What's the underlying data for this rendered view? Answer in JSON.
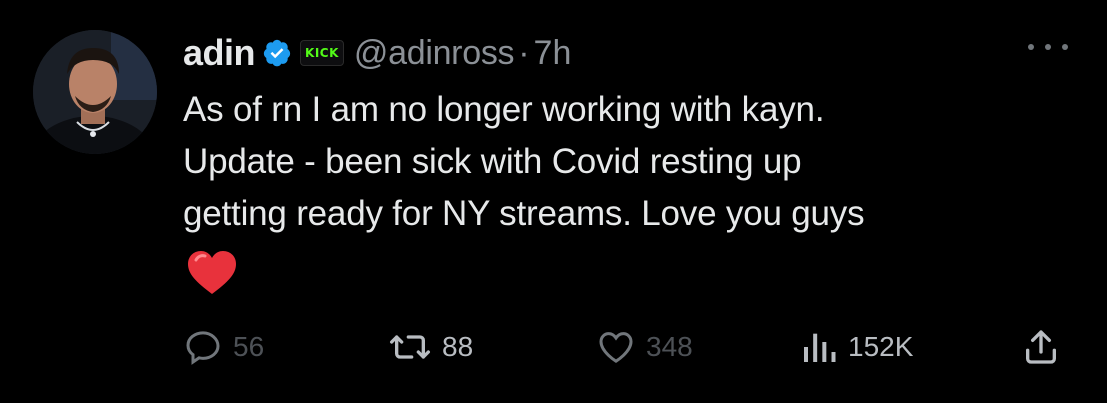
{
  "author": {
    "display_name": "adin",
    "handle": "@adinross",
    "separator": "·",
    "time": "7h",
    "kick_badge": "KICK"
  },
  "tweet": {
    "lines": [
      "As of rn I am no longer working with kayn.",
      "Update - been sick with Covid resting up",
      "getting ready for NY streams. Love you guys"
    ],
    "emoji": "red-heart"
  },
  "actions": {
    "replies": "56",
    "retweets": "88",
    "likes": "348",
    "views": "152K"
  },
  "icons": {
    "verified": "verified-badge-icon",
    "more": "more-icon",
    "reply": "reply-icon",
    "retweet": "retweet-icon",
    "like": "heart-icon",
    "views": "views-icon",
    "share": "share-icon"
  },
  "colors": {
    "background": "#000000",
    "text": "#e7e9ea",
    "secondary": "#8b9096",
    "verified_blue": "#1d9bf0",
    "kick_green": "#53fc18",
    "heart_red": "#e0245e"
  }
}
